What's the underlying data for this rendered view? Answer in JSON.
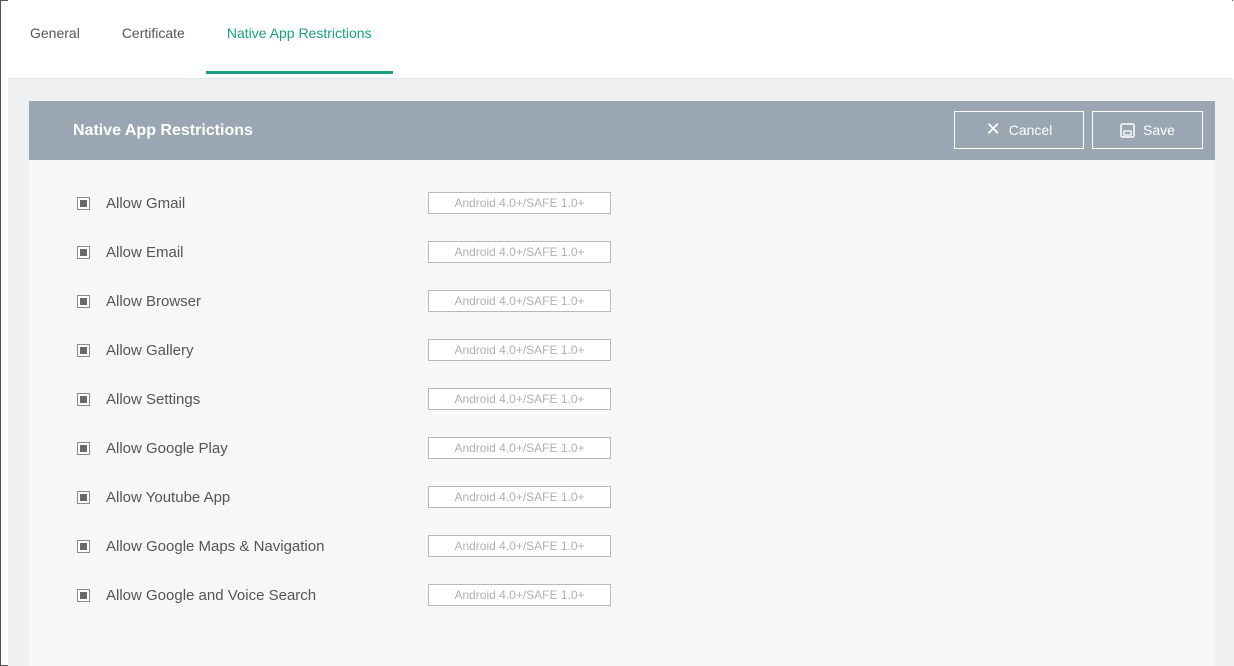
{
  "tabs": [
    {
      "label": "General",
      "active": false
    },
    {
      "label": "Certificate",
      "active": false
    },
    {
      "label": "Native App Restrictions",
      "active": true
    }
  ],
  "panel": {
    "title": "Native App Restrictions",
    "cancel_label": "Cancel",
    "save_label": "Save",
    "cancel_icon": "close-icon",
    "save_icon": "save-icon"
  },
  "restrictions": [
    {
      "label": "Allow Gmail",
      "badge": "Android 4.0+/SAFE 1.0+"
    },
    {
      "label": "Allow Email",
      "badge": "Android 4.0+/SAFE 1.0+"
    },
    {
      "label": "Allow Browser",
      "badge": "Android 4.0+/SAFE 1.0+"
    },
    {
      "label": "Allow Gallery",
      "badge": "Android 4.0+/SAFE 1.0+"
    },
    {
      "label": "Allow Settings",
      "badge": "Android 4.0+/SAFE 1.0+"
    },
    {
      "label": "Allow Google Play",
      "badge": "Android 4.0+/SAFE 1.0+"
    },
    {
      "label": "Allow Youtube App",
      "badge": "Android 4.0+/SAFE 1.0+"
    },
    {
      "label": "Allow Google Maps & Navigation",
      "badge": "Android 4.0+/SAFE 1.0+"
    },
    {
      "label": "Allow Google and Voice Search",
      "badge": "Android 4.0+/SAFE 1.0+"
    }
  ],
  "colors": {
    "accent": "#1aa085",
    "header_bg": "#9aa7b2"
  }
}
